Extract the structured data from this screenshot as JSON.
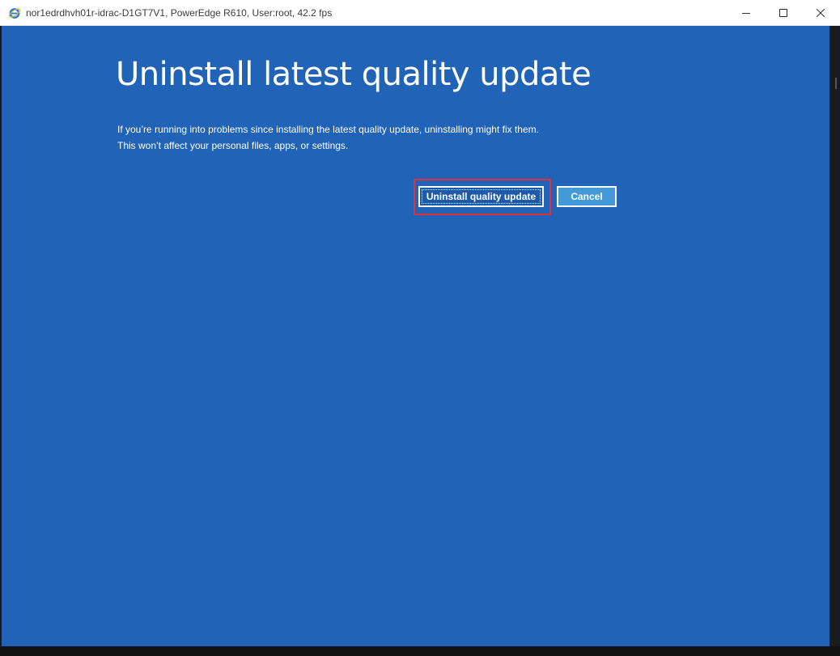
{
  "window": {
    "title": "nor1edrdhvh01r-idrac-D1GT7V1, PowerEdge R610, User:root, 42.2 fps",
    "icon": "internet-explorer-icon",
    "controls": {
      "minimize": "minimize-icon",
      "maximize": "maximize-icon",
      "close": "close-icon"
    }
  },
  "screen": {
    "background_color": "#2163b6",
    "heading": "Uninstall latest quality update",
    "description": [
      "If you’re running into problems since installing the latest quality update, uninstalling might fix them.",
      "This won’t affect your personal files, apps, or settings."
    ],
    "buttons": {
      "primary_label": "Uninstall quality update",
      "secondary_label": "Cancel"
    },
    "highlight_color": "#e0313a"
  }
}
